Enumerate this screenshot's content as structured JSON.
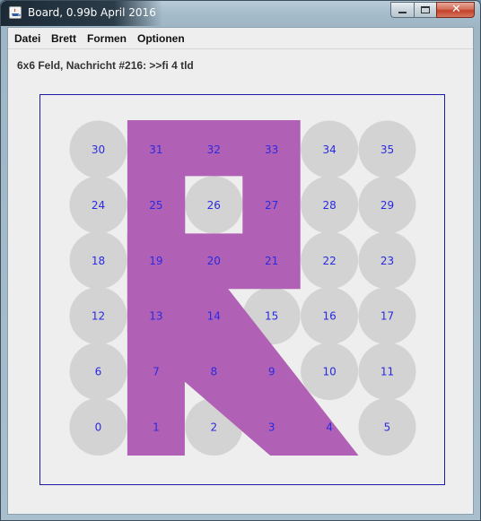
{
  "window": {
    "title": "Board, 0.99b April 2016",
    "close_glyph": "✕"
  },
  "menu": [
    "Datei",
    "Brett",
    "Formen",
    "Optionen"
  ],
  "status": "6x6 Feld, Nachricht #216: >>fi 4 tld",
  "board": {
    "cols": 6,
    "rows": 6,
    "circle_color": "#d3d3d3",
    "shape_color": "#b161b5",
    "label_color": "#2a2ae0",
    "frame_color": "#1b1ba8",
    "cells": [
      {
        "n": 30,
        "row": 0,
        "col": 0,
        "circle": true
      },
      {
        "n": 31,
        "row": 0,
        "col": 1,
        "circle": false
      },
      {
        "n": 32,
        "row": 0,
        "col": 2,
        "circle": false
      },
      {
        "n": 33,
        "row": 0,
        "col": 3,
        "circle": false
      },
      {
        "n": 34,
        "row": 0,
        "col": 4,
        "circle": true
      },
      {
        "n": 35,
        "row": 0,
        "col": 5,
        "circle": true
      },
      {
        "n": 24,
        "row": 1,
        "col": 0,
        "circle": true
      },
      {
        "n": 25,
        "row": 1,
        "col": 1,
        "circle": false
      },
      {
        "n": 26,
        "row": 1,
        "col": 2,
        "circle": true
      },
      {
        "n": 27,
        "row": 1,
        "col": 3,
        "circle": false
      },
      {
        "n": 28,
        "row": 1,
        "col": 4,
        "circle": true
      },
      {
        "n": 29,
        "row": 1,
        "col": 5,
        "circle": true
      },
      {
        "n": 18,
        "row": 2,
        "col": 0,
        "circle": true
      },
      {
        "n": 19,
        "row": 2,
        "col": 1,
        "circle": false
      },
      {
        "n": 20,
        "row": 2,
        "col": 2,
        "circle": false
      },
      {
        "n": 21,
        "row": 2,
        "col": 3,
        "circle": false
      },
      {
        "n": 22,
        "row": 2,
        "col": 4,
        "circle": true
      },
      {
        "n": 23,
        "row": 2,
        "col": 5,
        "circle": true
      },
      {
        "n": 12,
        "row": 3,
        "col": 0,
        "circle": true
      },
      {
        "n": 13,
        "row": 3,
        "col": 1,
        "circle": false
      },
      {
        "n": 14,
        "row": 3,
        "col": 2,
        "circle": false
      },
      {
        "n": 15,
        "row": 3,
        "col": 3,
        "circle": true
      },
      {
        "n": 16,
        "row": 3,
        "col": 4,
        "circle": true
      },
      {
        "n": 17,
        "row": 3,
        "col": 5,
        "circle": true
      },
      {
        "n": 6,
        "row": 4,
        "col": 0,
        "circle": true
      },
      {
        "n": 7,
        "row": 4,
        "col": 1,
        "circle": false
      },
      {
        "n": 8,
        "row": 4,
        "col": 2,
        "circle": false
      },
      {
        "n": 9,
        "row": 4,
        "col": 3,
        "circle": false
      },
      {
        "n": 10,
        "row": 4,
        "col": 4,
        "circle": true
      },
      {
        "n": 11,
        "row": 4,
        "col": 5,
        "circle": true
      },
      {
        "n": 0,
        "row": 5,
        "col": 0,
        "circle": true
      },
      {
        "n": 1,
        "row": 5,
        "col": 1,
        "circle": false
      },
      {
        "n": 2,
        "row": 5,
        "col": 2,
        "circle": true
      },
      {
        "n": 3,
        "row": 5,
        "col": 3,
        "circle": false
      },
      {
        "n": 4,
        "row": 5,
        "col": 4,
        "circle": false
      },
      {
        "n": 5,
        "row": 5,
        "col": 5,
        "circle": true
      }
    ]
  }
}
